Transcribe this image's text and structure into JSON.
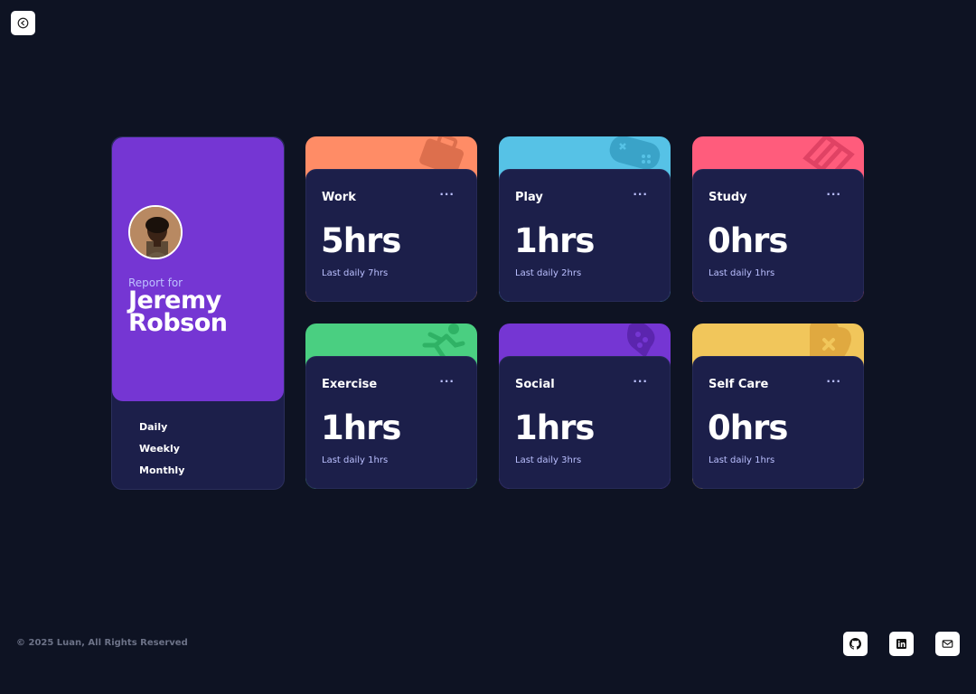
{
  "back": {
    "icon": "arrow-left-circle-icon"
  },
  "profile": {
    "report_for": "Report for",
    "name": "Jeremy Robson",
    "avatar": "avatar-photo",
    "accent": "#7536d3"
  },
  "timeframes": [
    "Daily",
    "Weekly",
    "Monthly"
  ],
  "activities": [
    {
      "title": "Work",
      "hours": "5hrs",
      "previous": "Last daily 7hrs",
      "color": "#ff8c66",
      "icon": "briefcase-icon",
      "menu": "···"
    },
    {
      "title": "Play",
      "hours": "1hrs",
      "previous": "Last daily 2hrs",
      "color": "#56c2e6",
      "icon": "gamepad-icon",
      "menu": "···"
    },
    {
      "title": "Study",
      "hours": "0hrs",
      "previous": "Last daily 1hrs",
      "color": "#ff5c7c",
      "icon": "books-icon",
      "menu": "···"
    },
    {
      "title": "Exercise",
      "hours": "1hrs",
      "previous": "Last daily 1hrs",
      "color": "#4acf81",
      "icon": "running-icon",
      "menu": "···"
    },
    {
      "title": "Social",
      "hours": "1hrs",
      "previous": "Last daily 3hrs",
      "color": "#7536d3",
      "icon": "social-icon",
      "menu": "···"
    },
    {
      "title": "Self Care",
      "hours": "0hrs",
      "previous": "Last daily 1hrs",
      "color": "#f1c65b",
      "icon": "heart-icon",
      "menu": "···"
    }
  ],
  "footer": {
    "copyright": "© 2025 Luan, All Rights Reserved",
    "links": [
      "github-icon",
      "linkedin-icon",
      "mail-icon"
    ]
  }
}
